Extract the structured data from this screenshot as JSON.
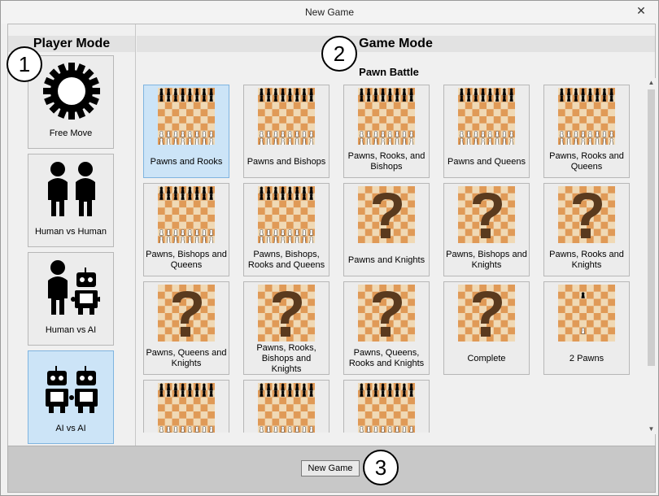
{
  "window": {
    "title": "New Game",
    "close_glyph": "✕"
  },
  "player_mode": {
    "header": "Player Mode",
    "items": [
      {
        "label": "Free Move",
        "icon": "gear-icon",
        "selected": false
      },
      {
        "label": "Human vs Human",
        "icon": "two-humans-icon",
        "selected": false
      },
      {
        "label": "Human vs AI",
        "icon": "human-robot-icon",
        "selected": false
      },
      {
        "label": "AI vs AI",
        "icon": "two-robots-icon",
        "selected": true
      }
    ]
  },
  "game_mode": {
    "header": "Game Mode",
    "section": "Pawn Battle",
    "items": [
      {
        "label": "Pawns and Rooks",
        "board": "preview",
        "selected": true
      },
      {
        "label": "Pawns and Bishops",
        "board": "preview",
        "selected": false
      },
      {
        "label": "Pawns, Rooks, and Bishops",
        "board": "preview",
        "selected": false
      },
      {
        "label": "Pawns and Queens",
        "board": "preview",
        "selected": false
      },
      {
        "label": "Pawns, Rooks and Queens",
        "board": "preview",
        "selected": false
      },
      {
        "label": "Pawns, Bishops and Queens",
        "board": "preview",
        "selected": false
      },
      {
        "label": "Pawns, Bishops, Rooks and Queens",
        "board": "preview",
        "selected": false
      },
      {
        "label": "Pawns and Knights",
        "board": "random",
        "selected": false
      },
      {
        "label": "Pawns, Bishops and Knights",
        "board": "random",
        "selected": false
      },
      {
        "label": "Pawns, Rooks and Knights",
        "board": "random",
        "selected": false
      },
      {
        "label": "Pawns, Queens and Knights",
        "board": "random",
        "selected": false
      },
      {
        "label": "Pawns, Rooks, Bishops and Knights",
        "board": "random",
        "selected": false
      },
      {
        "label": "Pawns, Queens, Rooks and Knights",
        "board": "random",
        "selected": false
      },
      {
        "label": "Complete",
        "board": "random",
        "selected": false
      },
      {
        "label": "2 Pawns",
        "board": "two-pawns",
        "selected": false
      },
      {
        "label": "",
        "board": "preview",
        "selected": false
      },
      {
        "label": "",
        "board": "preview",
        "selected": false
      },
      {
        "label": "",
        "board": "preview",
        "selected": false
      }
    ]
  },
  "footer": {
    "new_game_label": "New Game"
  },
  "callouts": [
    "1",
    "2",
    "3"
  ],
  "colors": {
    "light_square": "#f0d9b5",
    "dark_square": "#e09a57",
    "selected_bg": "#cce4f7",
    "question_mark": "#5a3a1e"
  }
}
